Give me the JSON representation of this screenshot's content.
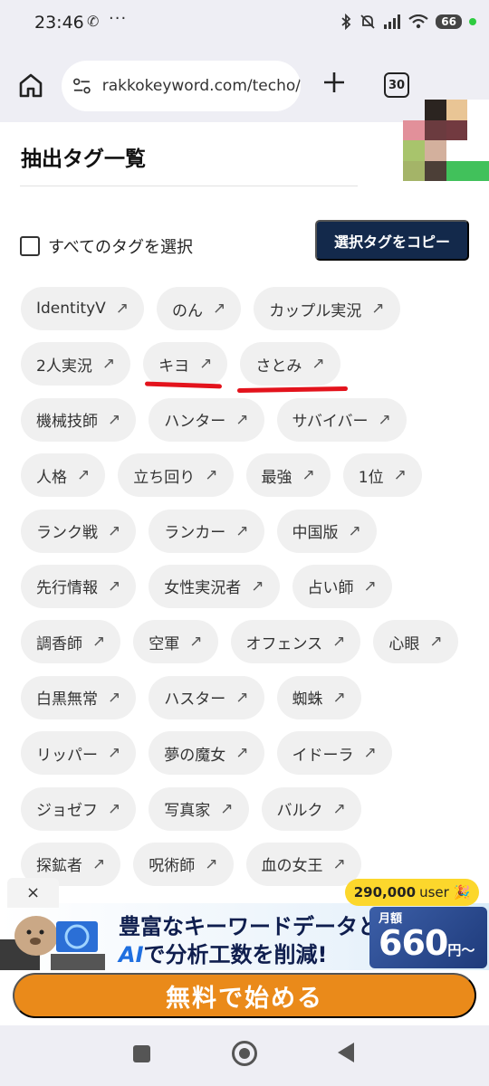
{
  "status_bar": {
    "time": "23:46",
    "battery": "66",
    "icons": [
      "phone-icon",
      "more-dots-icon",
      "bluetooth-icon",
      "mute-icon",
      "signal-icon",
      "wifi-icon",
      "battery-icon"
    ]
  },
  "browser": {
    "url": "rakkokeyword.com/techo/",
    "tab_count": "30",
    "icons": [
      "home-icon",
      "site-settings-icon",
      "new-tab-icon",
      "tab-switcher-icon"
    ]
  },
  "page": {
    "title": "抽出タグ一覧",
    "select_all_label": "すべてのタグを選択",
    "copy_button": "選択タグをコピー",
    "tag_arrow": "↗",
    "tags": [
      [
        "IdentityV",
        "のん",
        "カップル実況"
      ],
      [
        "2人実況",
        "キヨ",
        "さとみ"
      ],
      [
        "機械技師",
        "ハンター",
        "サバイバー"
      ],
      [
        "人格",
        "立ち回り",
        "最強",
        "1位"
      ],
      [
        "ランク戦",
        "ランカー",
        "中国版"
      ],
      [
        "先行情報",
        "女性実況者",
        "占い師"
      ],
      [
        "調香師",
        "空軍",
        "オフェンス",
        "心眼"
      ],
      [
        "白黒無常",
        "ハスター",
        "蜘蛛"
      ],
      [
        "リッパー",
        "夢の魔女",
        "イドーラ"
      ],
      [
        "ジョゼフ",
        "写真家",
        "バルク"
      ],
      [
        "探鉱者",
        "呪術師",
        "血の女王"
      ]
    ],
    "highlighted_tags": [
      "キヨ",
      "さとみ"
    ],
    "highlight_color": "#e3131c"
  },
  "ad": {
    "close": "×",
    "user_count": "290,000",
    "user_suffix": "user 🎉",
    "headline_1": "豊富なキーワードデータと",
    "headline_2_ai": "AI",
    "headline_2_rest": "で分析工数を削減!",
    "price_label": "月額",
    "price_value": "660",
    "price_unit": "円〜",
    "cta": "無料で始める",
    "cta_color": "#ea8a1a"
  },
  "nav": {
    "icons": [
      "recent-apps-icon",
      "home-circle-icon",
      "back-icon"
    ]
  }
}
